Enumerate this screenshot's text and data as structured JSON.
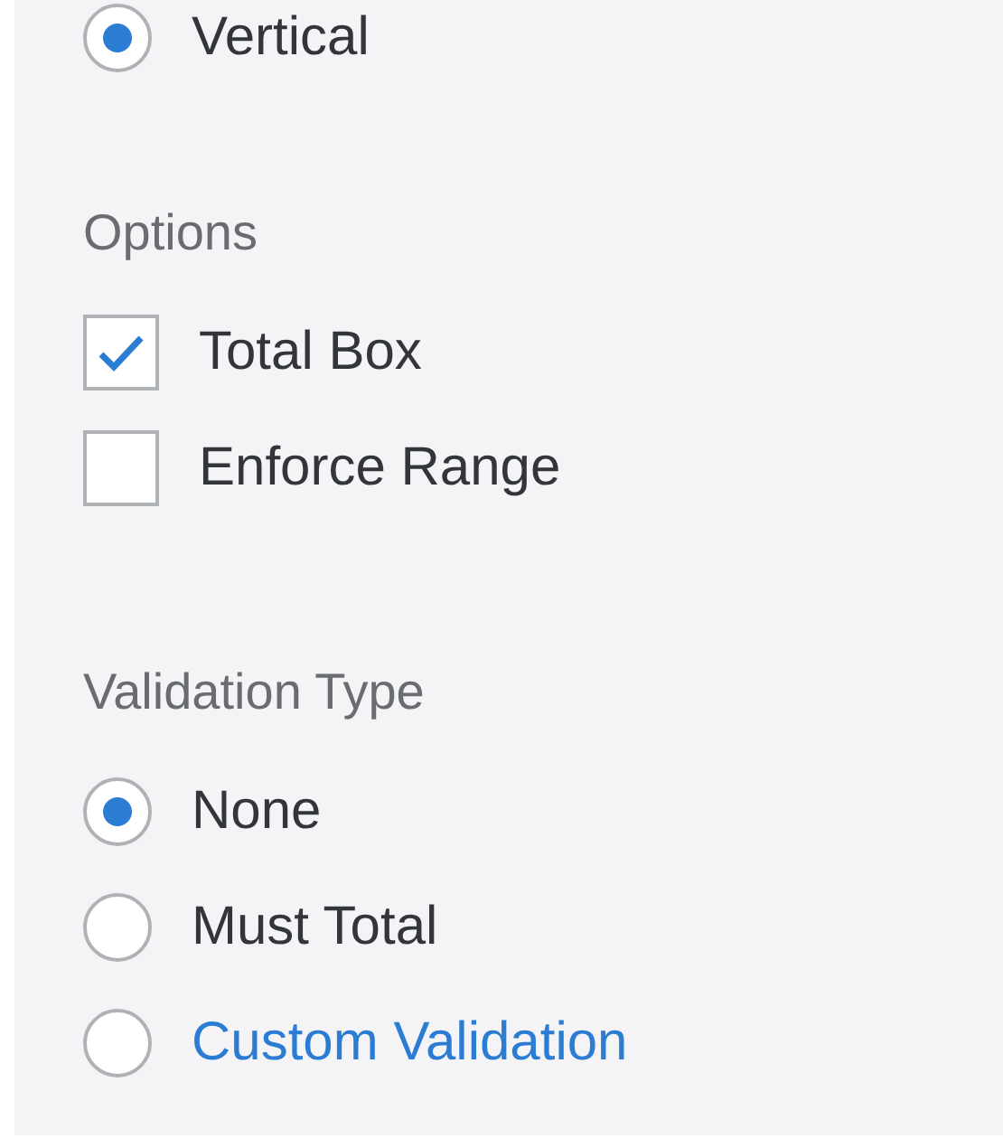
{
  "sections": [
    {
      "kind": "radio",
      "items": [
        {
          "label": "Vertical",
          "selected": true,
          "link": false
        }
      ]
    },
    {
      "heading": "Options",
      "kind": "checkbox",
      "items": [
        {
          "label": "Total Box",
          "checked": true
        },
        {
          "label": "Enforce Range",
          "checked": false
        }
      ]
    },
    {
      "heading": "Validation Type",
      "kind": "radio",
      "items": [
        {
          "label": "None",
          "selected": true,
          "link": false
        },
        {
          "label": "Must Total",
          "selected": false,
          "link": false
        },
        {
          "label": "Custom Validation",
          "selected": false,
          "link": true
        }
      ]
    }
  ]
}
